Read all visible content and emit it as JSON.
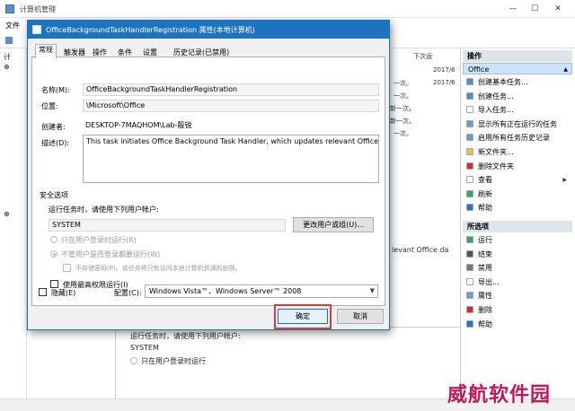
{
  "main_window": {
    "title": "计算机管理",
    "menu": [
      "文件"
    ],
    "tree_items": [
      "计",
      "⊕",
      "⊕"
    ],
    "list_header": "下次运",
    "list_rows": [
      {
        "date": "2017/6",
        "text": ""
      },
      {
        "date": "2017/6",
        "text": "一次。"
      },
      {
        "date": "",
        "text": "一次。"
      },
      {
        "date": "",
        "text": "新一次。"
      },
      {
        "date": "",
        "text": "新一次。"
      },
      {
        "date": "",
        "text": "一次。"
      }
    ],
    "list_fragment": "levant Office da",
    "detail_pane": {
      "run_as_label": "运行任务时，请使用下列用户帐户:",
      "run_as_value": "SYSTEM",
      "radio_1": "只在用户登录时运行"
    }
  },
  "actions": {
    "section1_title": "操作",
    "section1_selected": "Office",
    "section1_items": [
      {
        "label": "创建基本任务...",
        "icon": "create-basic-task-icon",
        "color": "#4a8fd4"
      },
      {
        "label": "创建任务...",
        "icon": "create-task-icon",
        "color": "#4a8fd4"
      },
      {
        "label": "导入任务...",
        "icon": "import-task-icon",
        "color": "#ffffff"
      },
      {
        "label": "显示所有正在运行的任务",
        "icon": "running-tasks-icon",
        "color": "#6b9bd1"
      },
      {
        "label": "启用所有任务历史记录",
        "icon": "history-icon",
        "color": "#6b9bd1"
      },
      {
        "label": "新文件夹...",
        "icon": "new-folder-icon",
        "color": "#e8c15a"
      },
      {
        "label": "删除文件夹",
        "icon": "delete-folder-icon",
        "color": "#d32f2f"
      },
      {
        "label": "查看",
        "icon": "view-icon",
        "color": "#ffffff",
        "submenu": true
      },
      {
        "label": "刷新",
        "icon": "refresh-icon",
        "color": "#3aa657"
      },
      {
        "label": "帮助",
        "icon": "help-icon",
        "color": "#2f6fbf"
      }
    ],
    "section2_title": "所选项",
    "section2_items": [
      {
        "label": "运行",
        "icon": "run-icon",
        "color": "#3aa657"
      },
      {
        "label": "结束",
        "icon": "stop-icon",
        "color": "#555555"
      },
      {
        "label": "禁用",
        "icon": "disable-icon",
        "color": "#777777"
      },
      {
        "label": "导出...",
        "icon": "export-icon",
        "color": "#ffffff"
      },
      {
        "label": "属性",
        "icon": "properties-icon",
        "color": "#6b9bd1"
      },
      {
        "label": "删除",
        "icon": "delete-icon",
        "color": "#d32f2f"
      },
      {
        "label": "帮助",
        "icon": "help-icon",
        "color": "#2f6fbf"
      }
    ]
  },
  "dialog": {
    "title": "OfficeBackgroundTaskHandlerRegistration 属性(本地计算机)",
    "tabs": [
      "常规",
      "触发器",
      "操作",
      "条件",
      "设置",
      "历史记录(已禁用)"
    ],
    "active_tab": 0,
    "name_label": "名称(M):",
    "name_value": "OfficeBackgroundTaskHandlerRegistration",
    "location_label": "位置:",
    "location_value": "\\Microsoft\\Office",
    "author_label": "创建者:",
    "author_value": "DESKTOP-7MAQHOM\\Lab-殷锐",
    "desc_label": "描述(D):",
    "desc_value": "This task initiates Office Background Task Handler, which updates relevant Office data.",
    "security": {
      "title": "安全选项",
      "run_as_label": "运行任务时，请使用下列用户帐户:",
      "account": "SYSTEM",
      "change_button": "更改用户或组(U)...",
      "radio_logged_on": "只在用户登录时运行(R)",
      "radio_whether": "不管用户是否登录都要运行(W)",
      "no_store_password": "不存储密码(P)。该任务将只有访问本地计算机资源的权限。",
      "highest_privileges": "使用最高权限运行(I)"
    },
    "hidden_label": "隐藏(E)",
    "configure_label": "配置(C):",
    "configure_value": "Windows Vista™、Windows Server™ 2008",
    "ok_button": "确定",
    "cancel_button": "取消"
  },
  "watermark": "威航软件园",
  "colors": {
    "accent": "#1e73be",
    "highlight": "#e53935",
    "watermark": "#c2185b"
  }
}
